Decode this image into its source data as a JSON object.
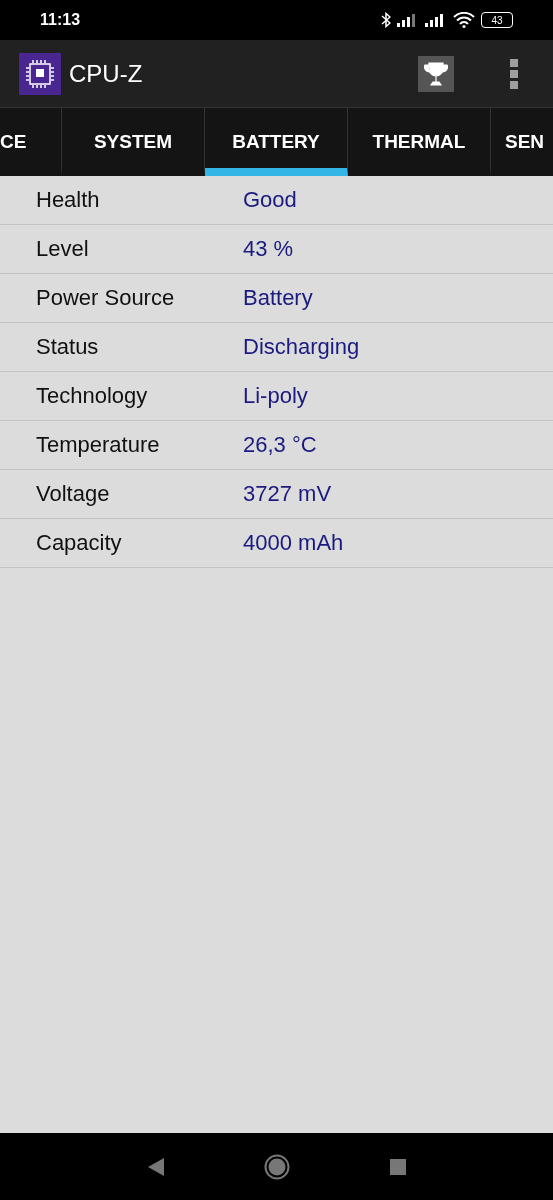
{
  "status_bar": {
    "time": "11:13",
    "battery": "43"
  },
  "app_bar": {
    "title": "CPU-Z"
  },
  "tabs": [
    {
      "label": "CE",
      "selected": false
    },
    {
      "label": "SYSTEM",
      "selected": false
    },
    {
      "label": "BATTERY",
      "selected": true
    },
    {
      "label": "THERMAL",
      "selected": false
    },
    {
      "label": "SEN",
      "selected": false
    }
  ],
  "rows": [
    {
      "label": "Health",
      "value": "Good"
    },
    {
      "label": "Level",
      "value": "43 %"
    },
    {
      "label": "Power Source",
      "value": "Battery"
    },
    {
      "label": "Status",
      "value": "Discharging"
    },
    {
      "label": "Technology",
      "value": "Li-poly"
    },
    {
      "label": "Temperature",
      "value": "26,3 °C"
    },
    {
      "label": "Voltage",
      "value": "3727 mV"
    },
    {
      "label": "Capacity",
      "value": "4000 mAh"
    }
  ]
}
